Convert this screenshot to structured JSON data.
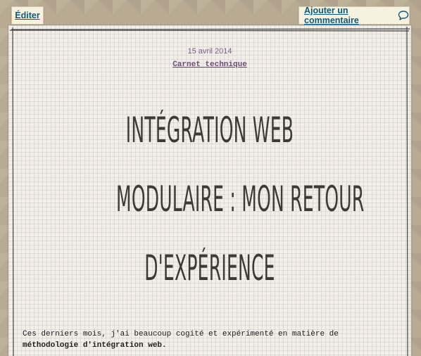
{
  "toolbar": {
    "edit_label": "Éditer",
    "comment_label": "Ajouter un commentaire",
    "comment_icon": "speech-bubble-icon"
  },
  "post": {
    "date": "15 avril 2014",
    "category": "Carnet technique",
    "title_lines": [
      "INTÉGRATION WEB",
      "MODULAIRE : MON RETOUR",
      "D'EXPÉRIENCE"
    ],
    "intro_before": "Ces derniers mois, j'ai beaucoup cogité et expérimenté en matière de ",
    "intro_bold": "méthodologie d'intégration web",
    "intro_after": "."
  },
  "colors": {
    "link": "#0d5b7a",
    "category": "#6e4c7a",
    "title": "#3c3a36",
    "paper": "#f3efe6"
  }
}
